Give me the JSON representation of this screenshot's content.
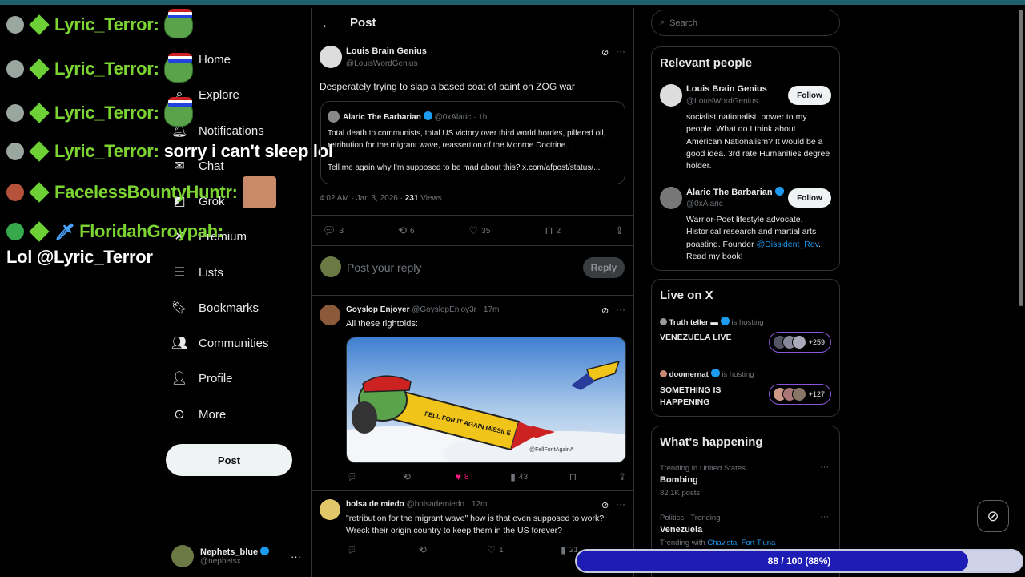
{
  "nav": {
    "items": [
      {
        "label": "Home",
        "icon": "home-icon"
      },
      {
        "label": "Explore",
        "icon": "search-icon"
      },
      {
        "label": "Notifications",
        "icon": "bell-icon"
      },
      {
        "label": "Chat",
        "icon": "chat-icon"
      },
      {
        "label": "Grok",
        "icon": "grok-icon"
      },
      {
        "label": "Premium",
        "icon": "x-premium-icon"
      },
      {
        "label": "Lists",
        "icon": "list-icon"
      },
      {
        "label": "Bookmarks",
        "icon": "bookmark-icon"
      },
      {
        "label": "Communities",
        "icon": "communities-icon"
      },
      {
        "label": "Profile",
        "icon": "profile-icon"
      },
      {
        "label": "More",
        "icon": "more-circle-icon"
      }
    ],
    "post_button": "Post",
    "account": {
      "name": "Nephets_blue",
      "handle": "@nephetsx"
    }
  },
  "chat": [
    {
      "user": "Lyric_Terror:",
      "message": ""
    },
    {
      "user": "Lyric_Terror:",
      "message": ""
    },
    {
      "user": "Lyric_Terror:",
      "message": ""
    },
    {
      "user": "Lyric_Terror:",
      "message": "sorry i can't sleep lol"
    },
    {
      "user": "FacelessBountyHuntr:",
      "message": ""
    },
    {
      "user": "FloridahGroypah:",
      "message": "Lol @Lyric_Terror"
    }
  ],
  "header": {
    "title": "Post"
  },
  "main_post": {
    "author": "Louis Brain Genius",
    "handle": "@LouisWordGenius",
    "text": "Desperately trying to slap a based coat of paint on ZOG war",
    "quote": {
      "author": "Alaric The Barbarian",
      "handle": "@0xAlaric",
      "time": "· 1h",
      "text": "Total death to communists, total US victory over third world hordes, pilfered oil, retribution for the migrant wave, reassertion of the Monroe Doctrine...",
      "text2": "Tell me again why I'm supposed to be mad about this? x.com/afpost/status/..."
    },
    "timestamp": "4:02 AM · Jan 3, 2026 · ",
    "views": "231",
    "views_label": " Views",
    "stats": {
      "replies": "3",
      "reposts": "6",
      "likes": "35",
      "bookmarks": "2"
    }
  },
  "reply_box": {
    "placeholder": "Post your reply",
    "button": "Reply"
  },
  "replies": [
    {
      "author": "Goyslop Enjoyer",
      "handle": "@GoyslopEnjoy3r",
      "time": "· 17m",
      "text": "All these rightoids:",
      "media_caption": "FELL FOR IT AGAIN MISSILE",
      "media_watermark": "@FellForItAgainA",
      "stats": {
        "replies": "",
        "reposts": "",
        "likes": "8",
        "views": "43"
      }
    },
    {
      "author": "bolsa de miedo",
      "handle": "@bolsademiedo",
      "time": "· 12m",
      "text": "\"retribution for the migrant wave\" how is that even supposed to work? Wreck their origin country to keep them in the US forever?",
      "stats": {
        "replies": "",
        "reposts": "",
        "likes": "1",
        "views": "21"
      }
    }
  ],
  "search": {
    "placeholder": "Search"
  },
  "relevant_people": {
    "title": "Relevant people",
    "people": [
      {
        "name": "Louis Brain Genius",
        "handle": "@LouisWordGenius",
        "bio": "socialist nationalist. power to my people. What do I think about American Nationalism? It would be a good idea. 3rd rate Humanities degree holder.",
        "button": "Follow"
      },
      {
        "name": "Alaric The Barbarian",
        "handle": "@0xAlaric",
        "bio": "Warrior-Poet lifestyle advocate. Historical research and martial arts poasting. Founder ",
        "bio_link": "@Dissident_Rev",
        "bio_end": ". Read my book!",
        "button": "Follow"
      }
    ]
  },
  "live": {
    "title": "Live on X",
    "items": [
      {
        "host": "Truth teller",
        "suffix": "is hosting",
        "title": "VENEZUELA LIVE",
        "count": "+259"
      },
      {
        "host": "doomernat",
        "suffix": "is hosting",
        "title": "SOMETHING IS HAPPENING",
        "count": "+127"
      }
    ]
  },
  "happening": {
    "title": "What's happening",
    "items": [
      {
        "context": "Trending in United States",
        "topic": "Bombing",
        "posts": "82.1K posts"
      },
      {
        "context": "Politics · Trending",
        "topic": "Venezuela",
        "posts": "Trending with ",
        "links": "Chavista, Fort Tiuna"
      }
    ]
  },
  "progress": {
    "value": 88,
    "max": 100,
    "label": "88 / 100 (88%)"
  }
}
